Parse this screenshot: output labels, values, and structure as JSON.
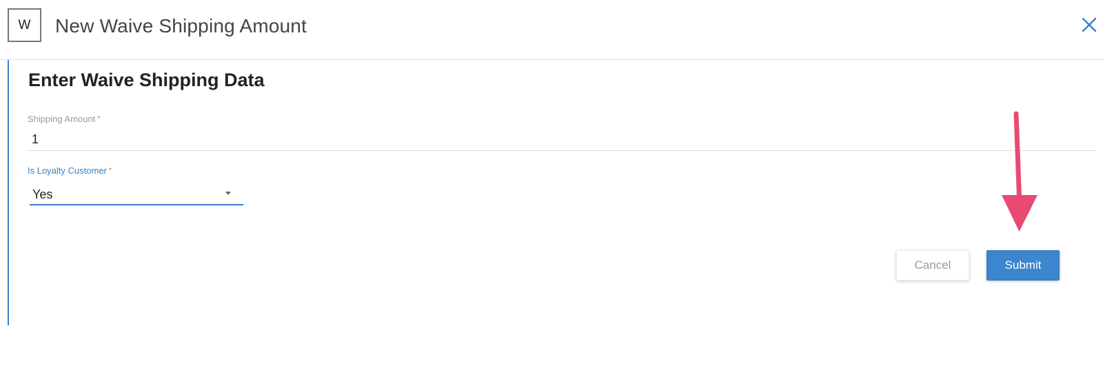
{
  "dialog": {
    "logo_letter": "W",
    "title": "New Waive Shipping Amount"
  },
  "form": {
    "section_title": "Enter Waive Shipping Data",
    "shipping_amount": {
      "label": "Shipping Amount",
      "required_mark": "*",
      "value": "1"
    },
    "loyalty_customer": {
      "label": "Is Loyalty Customer",
      "required_mark": "*",
      "selected": "Yes"
    }
  },
  "actions": {
    "cancel_label": "Cancel",
    "submit_label": "Submit"
  },
  "colors": {
    "accent": "#3b86cc",
    "arrow": "#e84a74",
    "required": "#d9534f"
  },
  "icons": {
    "close": "close-icon",
    "dropdown": "chevron-down-icon",
    "annotation": "arrow-down-icon"
  }
}
